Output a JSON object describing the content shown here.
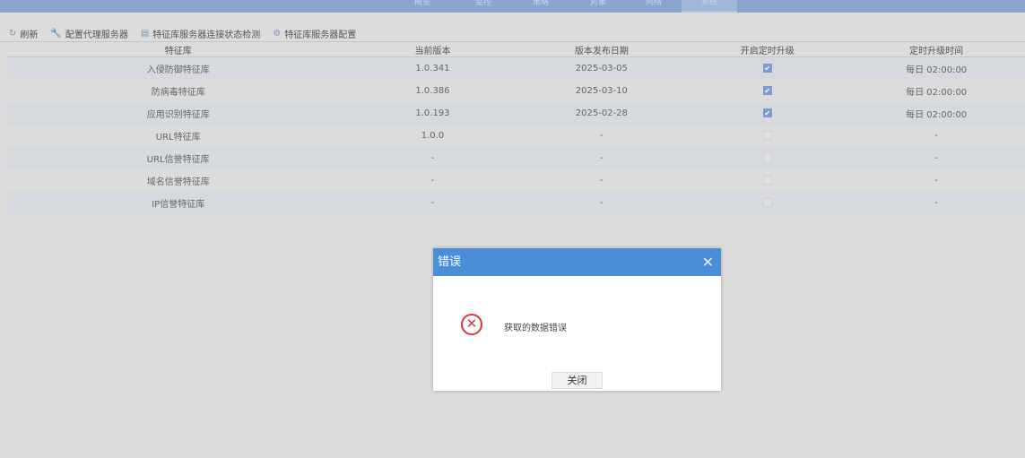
{
  "nav": {
    "tabs": [
      "概览",
      "监控",
      "策略",
      "对象",
      "网络",
      "系统"
    ],
    "active": 5
  },
  "toolbar": [
    {
      "icon": "refresh-icon",
      "label": "刷新",
      "glyph": "↻"
    },
    {
      "icon": "wrench-icon",
      "label": "配置代理服务器",
      "glyph": "🔧"
    },
    {
      "icon": "document-check-icon",
      "label": "特征库服务器连接状态检测",
      "glyph": "▤"
    },
    {
      "icon": "gear-icon",
      "label": "特征库服务器配置",
      "glyph": "⚙"
    }
  ],
  "table": {
    "headers": [
      "特征库",
      "当前版本",
      "版本发布日期",
      "开启定时升级",
      "定时升级时间"
    ],
    "rows": [
      {
        "name": "入侵防御特征库",
        "version": "1.0.341",
        "date": "2025-03-05",
        "auto": true,
        "time": "每日 02:00:00"
      },
      {
        "name": "防病毒特征库",
        "version": "1.0.386",
        "date": "2025-03-10",
        "auto": true,
        "time": "每日 02:00:00"
      },
      {
        "name": "应用识别特征库",
        "version": "1.0.193",
        "date": "2025-02-28",
        "auto": true,
        "time": "每日 02:00:00"
      },
      {
        "name": "URL特征库",
        "version": "1.0.0",
        "date": "-",
        "auto": false,
        "time": "-"
      },
      {
        "name": "URL信誉特征库",
        "version": "-",
        "date": "-",
        "auto": false,
        "time": "-"
      },
      {
        "name": "域名信誉特征库",
        "version": "-",
        "date": "-",
        "auto": false,
        "time": "-"
      },
      {
        "name": "IP信誉特征库",
        "version": "-",
        "date": "-",
        "auto": false,
        "time": "-"
      }
    ]
  },
  "dialog": {
    "title": "错误",
    "message": "获取的数据错误",
    "close_label": "关闭",
    "close_glyph": "✕",
    "error_glyph": "✕"
  }
}
